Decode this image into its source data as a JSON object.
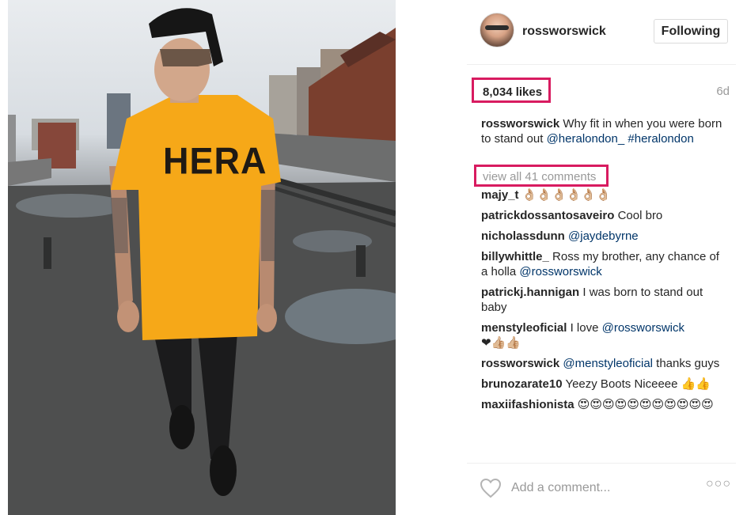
{
  "post": {
    "username": "rossworswick",
    "follow_label": "Following",
    "likes": "8,034 likes",
    "time": "6d",
    "shirt_text": "HERA"
  },
  "caption": {
    "username": "rossworswick",
    "text": "Why fit in when you were born to stand out",
    "mention": "@heralondon_",
    "hashtag": "#heralondon"
  },
  "view_all": "view all 41 comments",
  "comments": [
    {
      "user": "majy_t",
      "text": "",
      "emoji": "👌🏼👌🏼👌🏼👌🏼👌🏼👌🏼"
    },
    {
      "user": "patrickdossantosaveiro",
      "text": "Cool bro"
    },
    {
      "user": "nicholassdunn",
      "mention": "@jaydebyrne"
    },
    {
      "user": "billywhittle_",
      "text": "Ross my brother, any chance of a holla",
      "mention": "@rossworswick"
    },
    {
      "user": "patrickj.hannigan",
      "text": "I was born to stand out baby"
    },
    {
      "user": "menstyleoficial",
      "text": "I love",
      "mention": "@rossworswick",
      "emoji": "❤👍🏼👍🏼"
    },
    {
      "user": "rossworswick",
      "mention": "@menstyleoficial",
      "text": "thanks guys"
    },
    {
      "user": "brunozarate10",
      "text": "Yeezy Boots Niceeee",
      "emoji": "👍👍"
    },
    {
      "user": "maxiifashionista",
      "emoji": "😍😍😍😍😍😍😍😍😍😍😍"
    }
  ],
  "footer": {
    "add_comment_placeholder": "Add a comment...",
    "more_label": "○○○"
  },
  "colors": {
    "highlight": "#d81b60",
    "link": "#003569",
    "muted": "#999999"
  },
  "icons": {
    "like": "heart-icon",
    "more": "more-options-icon"
  }
}
